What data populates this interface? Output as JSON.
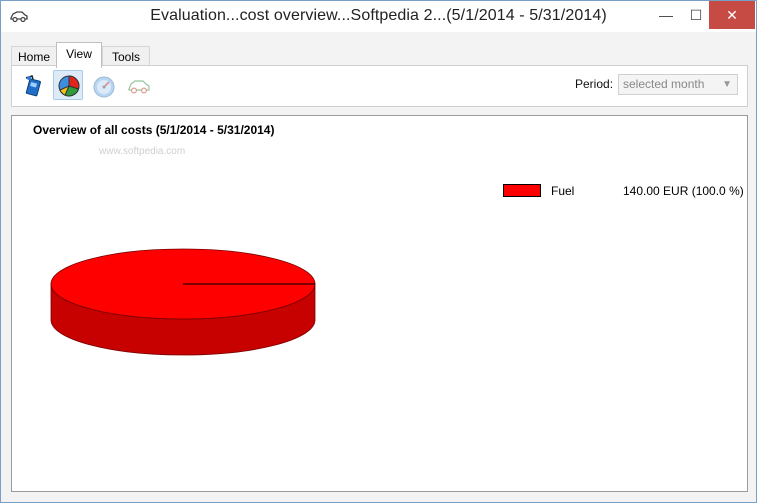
{
  "window": {
    "title": "Evaluation...cost overview...Softpedia 2...(5/1/2014 - 5/31/2014)",
    "minimize_glyph": "—",
    "maximize_glyph": "☐",
    "close_glyph": "✕"
  },
  "tabs": [
    {
      "label": "Home"
    },
    {
      "label": "View"
    },
    {
      "label": "Tools"
    }
  ],
  "toolbar": {
    "buttons": [
      {
        "icon": "fuel-pump-icon"
      },
      {
        "icon": "pie-chart-icon"
      },
      {
        "icon": "speedometer-icon"
      },
      {
        "icon": "car-icon"
      }
    ],
    "period_label": "Period:",
    "period_value": "selected month",
    "period_arrow": "▼"
  },
  "watermark": "www.softpedia.com",
  "chart_data": {
    "type": "pie",
    "title": "Overview of all costs (5/1/2014 - 5/31/2014)",
    "slices": [
      {
        "name": "Fuel",
        "value": 140.0,
        "unit": "EUR",
        "percent": 100.0,
        "color": "#ff0000"
      }
    ],
    "legend": [
      {
        "name": "Fuel",
        "value_text": "140.00  EUR  (100.0 %)"
      }
    ],
    "legend_position": "top-right"
  }
}
